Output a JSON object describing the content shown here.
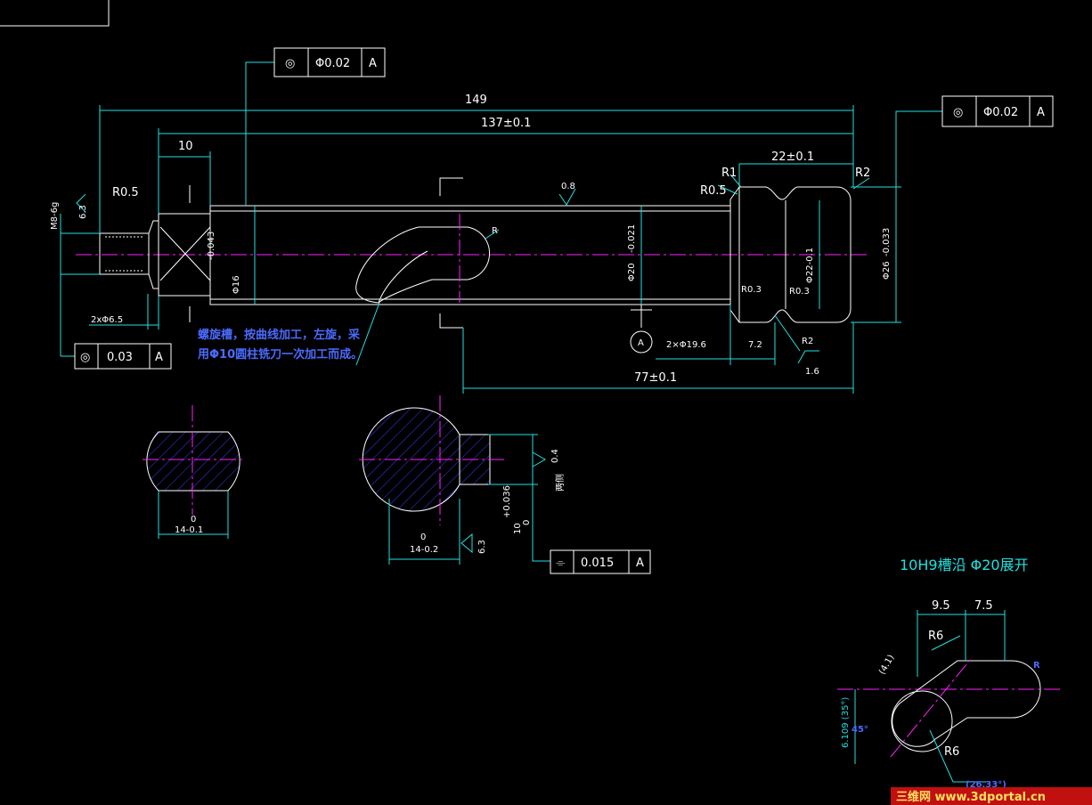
{
  "drawing": {
    "frame_fcf_top": {
      "symbol": "◎",
      "tolerance": "Φ0.02",
      "datum": "A"
    },
    "frame_fcf_right": {
      "symbol": "◎",
      "tolerance": "Φ0.02",
      "datum": "A"
    },
    "frame_fcf_left": {
      "symbol": "◎",
      "tolerance": "0.03",
      "datum": "A"
    },
    "frame_fcf_section": {
      "symbol": "⌯",
      "tolerance": "0.015",
      "datum": "A"
    },
    "dims": {
      "overall": "149",
      "length_137": "137±0.1",
      "ten": "10",
      "slot_22": "22±0.1",
      "r1": "R1",
      "r2_top": "R2",
      "r05_left": "R0.5",
      "r05_right": "R0.5",
      "r03_left": "R0.3",
      "r03_right": "R0.3",
      "m8": "M8-6g",
      "rough_63": "6.3",
      "rough_08": "0.8",
      "two_x_65": "2xΦ6.5",
      "phi16": "Φ16",
      "phi16_tol": "-0.043",
      "phi20": "Φ20",
      "phi20_tol": "-0.021",
      "phi22": "Φ22-0.1",
      "phi26": "Φ26",
      "phi26_tol": "-0.033",
      "two_x_196": "2×Φ19.6",
      "dim_72": "7.2",
      "r2_bottom": "R2",
      "rough_16": "1.6",
      "dim_77": "77±0.1",
      "datum_a": "A",
      "groove_r": "R",
      "zero": "0"
    },
    "note_line1": "螺旋槽，按曲线加工，左旋，采",
    "note_line2": "用Φ10圆柱铣刀一次加工而成。",
    "section_left": {
      "dim": "14-0.1",
      "dim_top": "0"
    },
    "section_mid": {
      "dim": "14-0.2",
      "dim_top": "0",
      "slot": "10",
      "slot_tol": "+0.036",
      "slot_tol2": "0",
      "rough_04": "0.4",
      "rough_63": "6.3",
      "note": "两侧"
    },
    "unroll": {
      "title": "10H9槽沿 Φ20展开",
      "d95": "9.5",
      "d75": "7.5",
      "r6_top": "R6",
      "r6_bottom": "R6",
      "d41": "(4.1)",
      "d6109": "6.109 (35°)",
      "deg45": "45°",
      "d2633": "(26.33°)",
      "small_r": "R"
    }
  },
  "colors": {
    "bg": "#000000",
    "cyan": "#22e0e0",
    "white": "#ffffff",
    "magenta": "#ff20ff",
    "blue": "#3a3aff"
  },
  "watermark": "三维网 www.3dportal.cn"
}
